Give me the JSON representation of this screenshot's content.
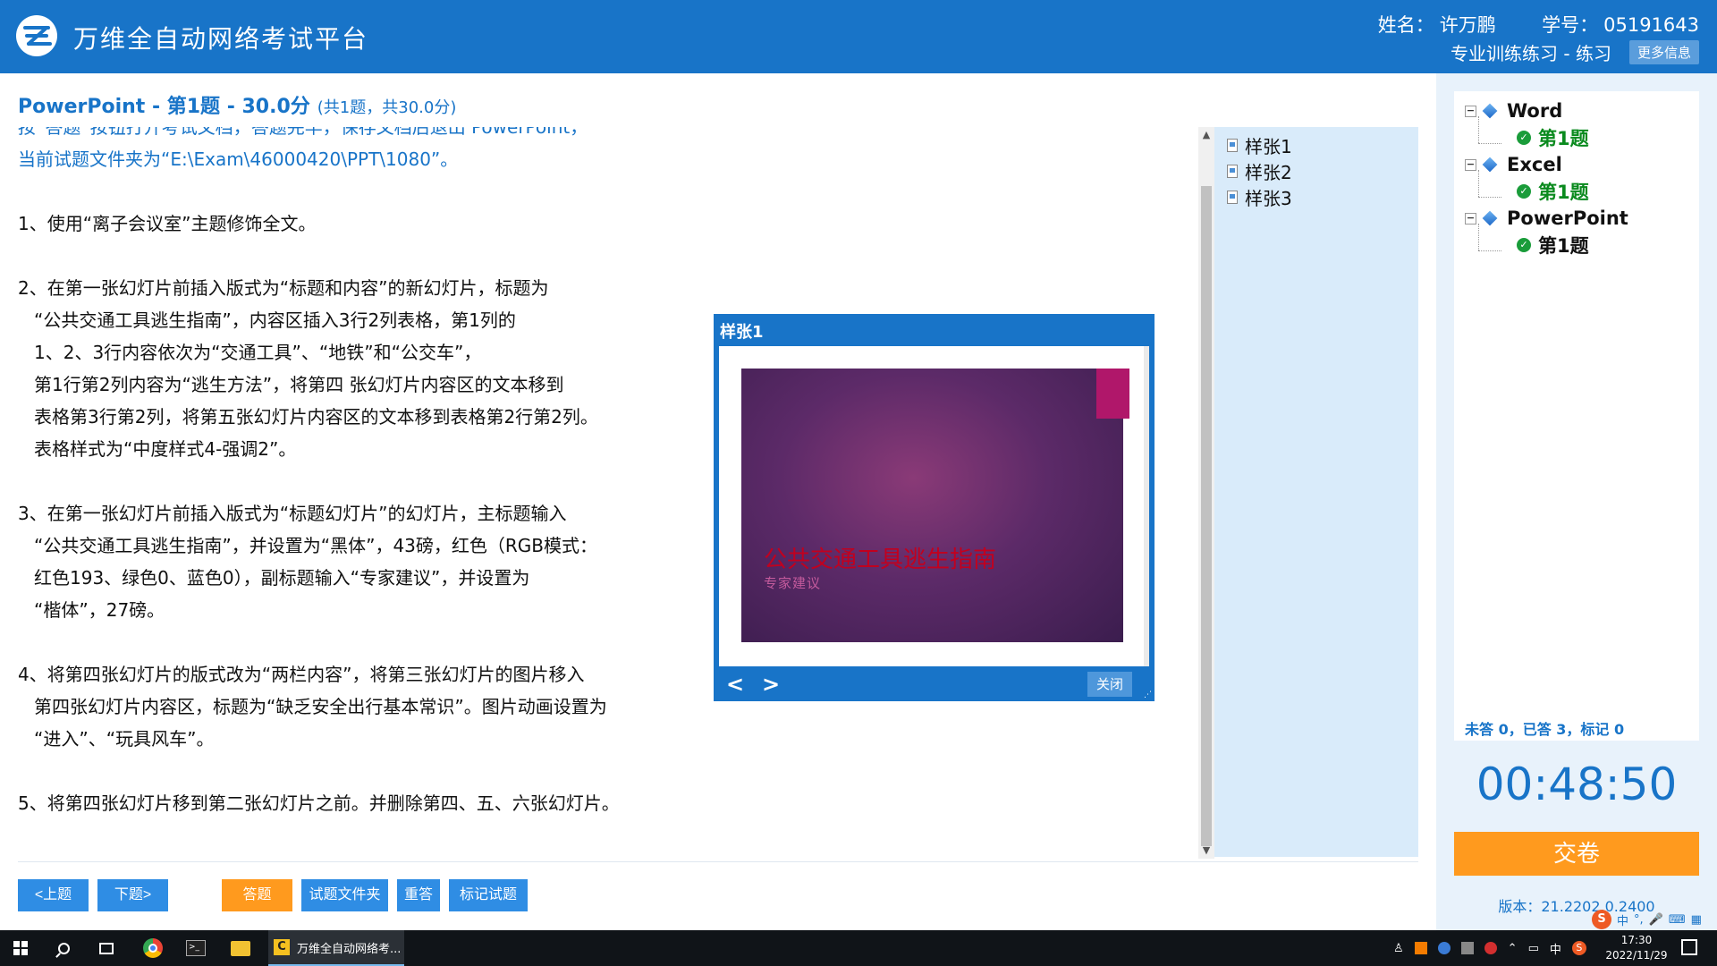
{
  "header": {
    "app_title": "万维全自动网络考试平台",
    "name_label": "姓名：",
    "name": "许万鹏",
    "id_label": "学号：",
    "student_id": "05191643",
    "mode": "专业训练练习 - 练习",
    "more_info": "更多信息"
  },
  "question": {
    "title": "PowerPoint - 第1题 - 30.0分",
    "subtitle": "(共1题，共30.0分)",
    "lines": [
      "按“答题”按钮打开考试文档，答题完毕，保存文档后退出 PowerPoint，",
      "当前试题文件夹为“E:\\Exam\\46000420\\PPT\\1080”。",
      "1、使用“离子会议室”主题修饰全文。",
      "2、在第一张幻灯片前插入版式为“标题和内容”的新幻灯片，标题为",
      "“公共交通工具逃生指南”，内容区插入3行2列表格，第1列的",
      "1、2、3行内容依次为“交通工具”、“地铁”和“公交车”，",
      "第1行第2列内容为“逃生方法”，将第四 张幻灯片内容区的文本移到",
      "表格第3行第2列，将第五张幻灯片内容区的文本移到表格第2行第2列。",
      "表格样式为“中度样式4-强调2”。",
      "3、在第一张幻灯片前插入版式为“标题幻灯片”的幻灯片，主标题输入",
      "“公共交通工具逃生指南”，并设置为“黑体”，43磅，红色（RGB模式：",
      "红色193、绿色0、蓝色0），副标题输入“专家建议”，并设置为",
      "“楷体”，27磅。",
      "4、将第四张幻灯片的版式改为“两栏内容”，将第三张幻灯片的图片移入",
      "第四张幻灯片内容区，标题为“缺乏安全出行基本常识”。图片动画设置为",
      "“进入”、“玩具风车”。",
      "5、将第四张幻灯片移到第二张幻灯片之前。并删除第四、五、六张幻灯片。"
    ]
  },
  "samples": {
    "items": [
      "样张1",
      "样张2",
      "样张3"
    ]
  },
  "popup": {
    "title": "样张1",
    "slide_title": "公共交通工具逃生指南",
    "slide_subtitle": "专家建议",
    "prev": "<",
    "next": ">",
    "close": "关闭"
  },
  "buttons": {
    "prev": "<上题",
    "next": "下题>",
    "answer": "答题",
    "folder": "试题文件夹",
    "redo": "重答",
    "mark": "标记试题"
  },
  "sidebar": {
    "tree": [
      {
        "label": "Word",
        "children": [
          "第1题"
        ]
      },
      {
        "label": "Excel",
        "children": [
          "第1题"
        ]
      },
      {
        "label": "PowerPoint",
        "children": [
          "第1题"
        ]
      }
    ],
    "stats": "未答 0，已答 3，标记 0",
    "timer": "00:48:50",
    "submit": "交卷",
    "version": "版本：21.2202.0.2400"
  },
  "ime": {
    "logo": "S",
    "mode": "中"
  },
  "taskbar": {
    "active_app": "万维全自动网络考...",
    "lang": "中",
    "time": "17:30",
    "date": "2022/11/29"
  },
  "colors": {
    "brand_blue": "#1874c8",
    "orange": "#ff9a1e",
    "slide_title_red": "#c1001f",
    "check_green": "#1a9c3a"
  }
}
